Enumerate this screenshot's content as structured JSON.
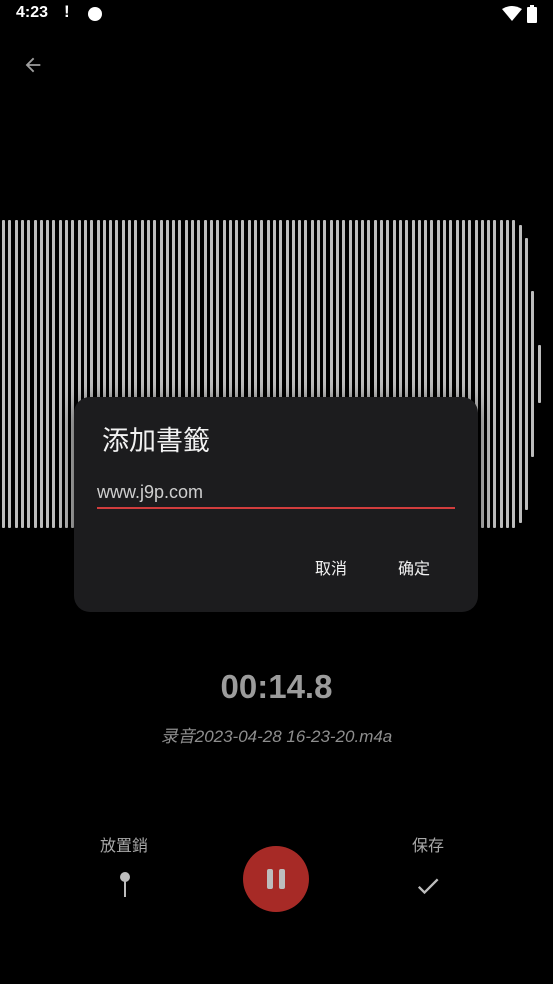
{
  "status_bar": {
    "time": "4:23",
    "alert_glyph": "!",
    "icons": [
      "notification-dot-icon",
      "wifi-icon",
      "battery-icon"
    ]
  },
  "toolbar": {
    "back_icon": "arrow-left-icon"
  },
  "waveform": {
    "bar_color": "#bdbdbd",
    "levels": [
      1,
      1,
      1,
      1,
      1,
      1,
      1,
      1,
      1,
      1,
      1,
      1,
      1,
      1,
      1,
      1,
      1,
      1,
      1,
      1,
      1,
      1,
      1,
      1,
      1,
      1,
      1,
      1,
      1,
      1,
      1,
      1,
      1,
      1,
      1,
      1,
      1,
      1,
      1,
      1,
      1,
      1,
      1,
      1,
      1,
      1,
      1,
      1,
      1,
      1,
      1,
      1,
      1,
      1,
      1,
      1,
      1,
      1,
      1,
      1,
      1,
      1,
      1,
      1,
      1,
      1,
      1,
      1,
      1,
      1,
      1,
      1,
      1,
      1,
      1,
      1,
      1,
      1,
      1,
      1,
      1,
      1,
      0.97,
      0.88,
      0.54,
      0.19
    ]
  },
  "dialog": {
    "title": "添加書籤",
    "input_value": "www.j9p.com",
    "input_underline_color": "#d13d3d",
    "cancel_label": "取消",
    "ok_label": "确定"
  },
  "recording": {
    "elapsed": "00:14.8",
    "filename": "录音2023-04-28 16-23-20.m4a"
  },
  "controls": {
    "pin_label": "放置銷",
    "pin_icon": "pin-icon",
    "pause_icon": "pause-icon",
    "pause_color": "#a72a26",
    "save_label": "保存",
    "save_icon": "check-icon"
  }
}
